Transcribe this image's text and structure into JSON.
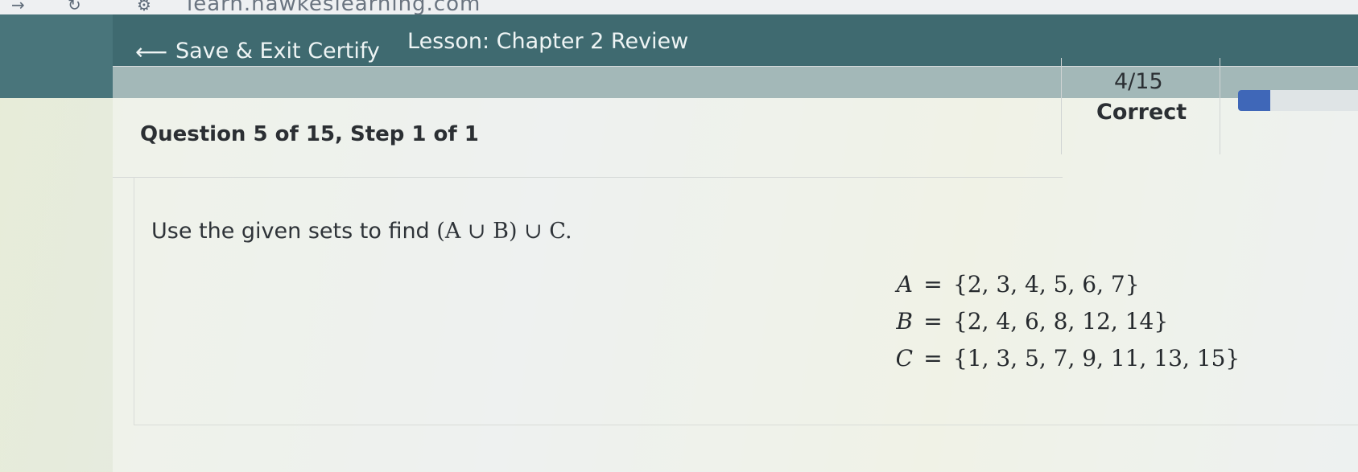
{
  "browser": {
    "back_icon": "arrow-right-icon",
    "reload_icon": "reload-icon",
    "site_icon": "site-settings-icon",
    "url": "learn.hawkeslearning.com"
  },
  "nav": {
    "back_icon": "arrow-left-icon",
    "save_exit_label": "Save & Exit Certify",
    "lesson_label": "Lesson: Chapter 2 Review"
  },
  "question": {
    "title": "Question 5 of 15, Step 1 of 1",
    "prompt_prefix": "Use the given sets to find ",
    "prompt_math": "(A ∪ B) ∪ C.",
    "sets": [
      {
        "name": "A",
        "value": "{2, 3, 4, 5, 6, 7}"
      },
      {
        "name": "B",
        "value": "{2, 4, 6, 8, 12, 14}"
      },
      {
        "name": "C",
        "value": "{1, 3, 5, 7, 9, 11, 13, 15}"
      }
    ]
  },
  "score": {
    "fraction": "4/15",
    "label": "Correct",
    "progress_fraction": 0.27
  },
  "colors": {
    "nav_bg": "#3f6a70",
    "progress_fill": "#3f67b8"
  }
}
